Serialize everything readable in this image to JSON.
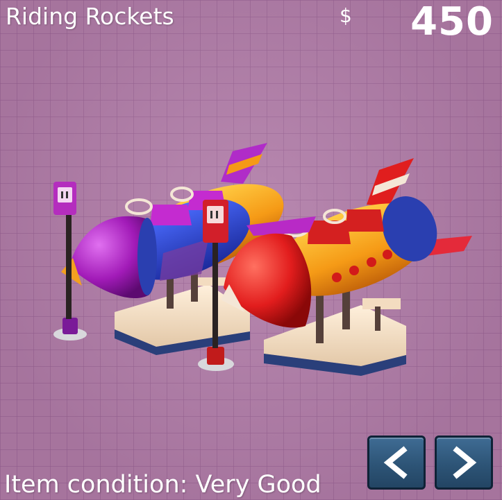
{
  "item": {
    "name": "Riding Rockets",
    "currency_symbol": "$",
    "price": "450",
    "condition_text": "Item condition: Very Good"
  },
  "navigation": {
    "previous_icon": "chevron-left-icon",
    "next_icon": "chevron-right-icon"
  },
  "colors": {
    "background": "#b07ba7",
    "button": "#2d5476",
    "rocket_left": "#a21bb8",
    "rocket_right": "#e21d1d"
  }
}
